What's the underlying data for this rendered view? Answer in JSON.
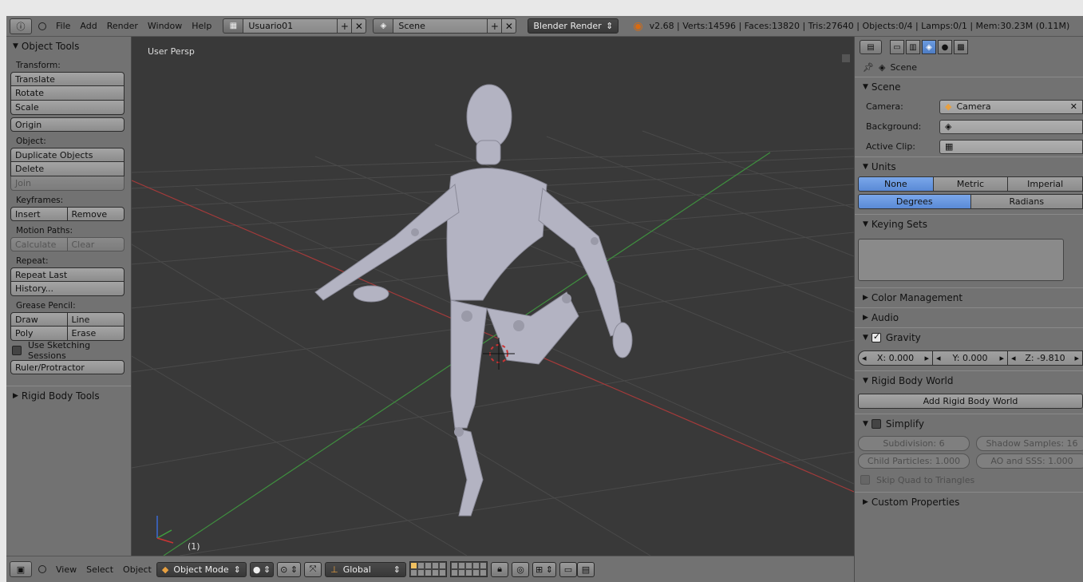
{
  "topbar": {
    "menus": [
      "File",
      "Add",
      "Render",
      "Window",
      "Help"
    ],
    "screen_layout": "Usuario01",
    "scene_name": "Scene",
    "render_engine": "Blender Render",
    "stats": "v2.68 | Verts:14596 | Faces:13820 | Tris:27640 | Objects:0/4 | Lamps:0/1 | Mem:30.23M (0.11M)"
  },
  "toolshelf": {
    "title": "Object Tools",
    "transform_label": "Transform:",
    "translate": "Translate",
    "rotate": "Rotate",
    "scale": "Scale",
    "origin": "Origin",
    "object_label": "Object:",
    "duplicate": "Duplicate Objects",
    "delete": "Delete",
    "join": "Join",
    "keyframes_label": "Keyframes:",
    "insert": "Insert",
    "remove": "Remove",
    "motion_paths_label": "Motion Paths:",
    "calculate": "Calculate",
    "clear": "Clear",
    "repeat_label": "Repeat:",
    "repeat_last": "Repeat Last",
    "history": "History...",
    "grease_label": "Grease Pencil:",
    "draw": "Draw",
    "line": "Line",
    "poly": "Poly",
    "erase": "Erase",
    "sketching": "Use Sketching Sessions",
    "ruler": "Ruler/Protractor",
    "rigid_body_tools": "Rigid Body Tools"
  },
  "viewport": {
    "view_label": "User Persp",
    "frame_label": "(1)"
  },
  "bottombar": {
    "menus": [
      "View",
      "Select",
      "Object"
    ],
    "mode": "Object Mode",
    "orientation": "Global"
  },
  "properties": {
    "breadcrumb": "Scene",
    "scene_section": "Scene",
    "camera_label": "Camera:",
    "camera_value": "Camera",
    "background_label": "Background:",
    "active_clip_label": "Active Clip:",
    "units_section": "Units",
    "unit_none": "None",
    "unit_metric": "Metric",
    "unit_imperial": "Imperial",
    "degrees": "Degrees",
    "radians": "Radians",
    "keying_sets": "Keying Sets",
    "color_management": "Color Management",
    "audio": "Audio",
    "gravity": "Gravity",
    "gravity_x": "X: 0.000",
    "gravity_y": "Y: 0.000",
    "gravity_z": "Z: -9.810",
    "rigid_body_world": "Rigid Body World",
    "add_rigid_body_world": "Add Rigid Body World",
    "simplify": "Simplify",
    "subdivision": "Subdivision: 6",
    "shadow_samples": "Shadow Samples: 16",
    "child_particles": "Child Particles: 1.000",
    "ao_sss": "AO and SSS: 1.000",
    "skip_quad": "Skip Quad to Triangles",
    "custom_properties": "Custom Properties"
  },
  "colors": {
    "panel_bg": "#727272",
    "viewport_bg": "#393939",
    "accent_blue": "#5a8ad6",
    "blender_orange": "#d86b12"
  }
}
